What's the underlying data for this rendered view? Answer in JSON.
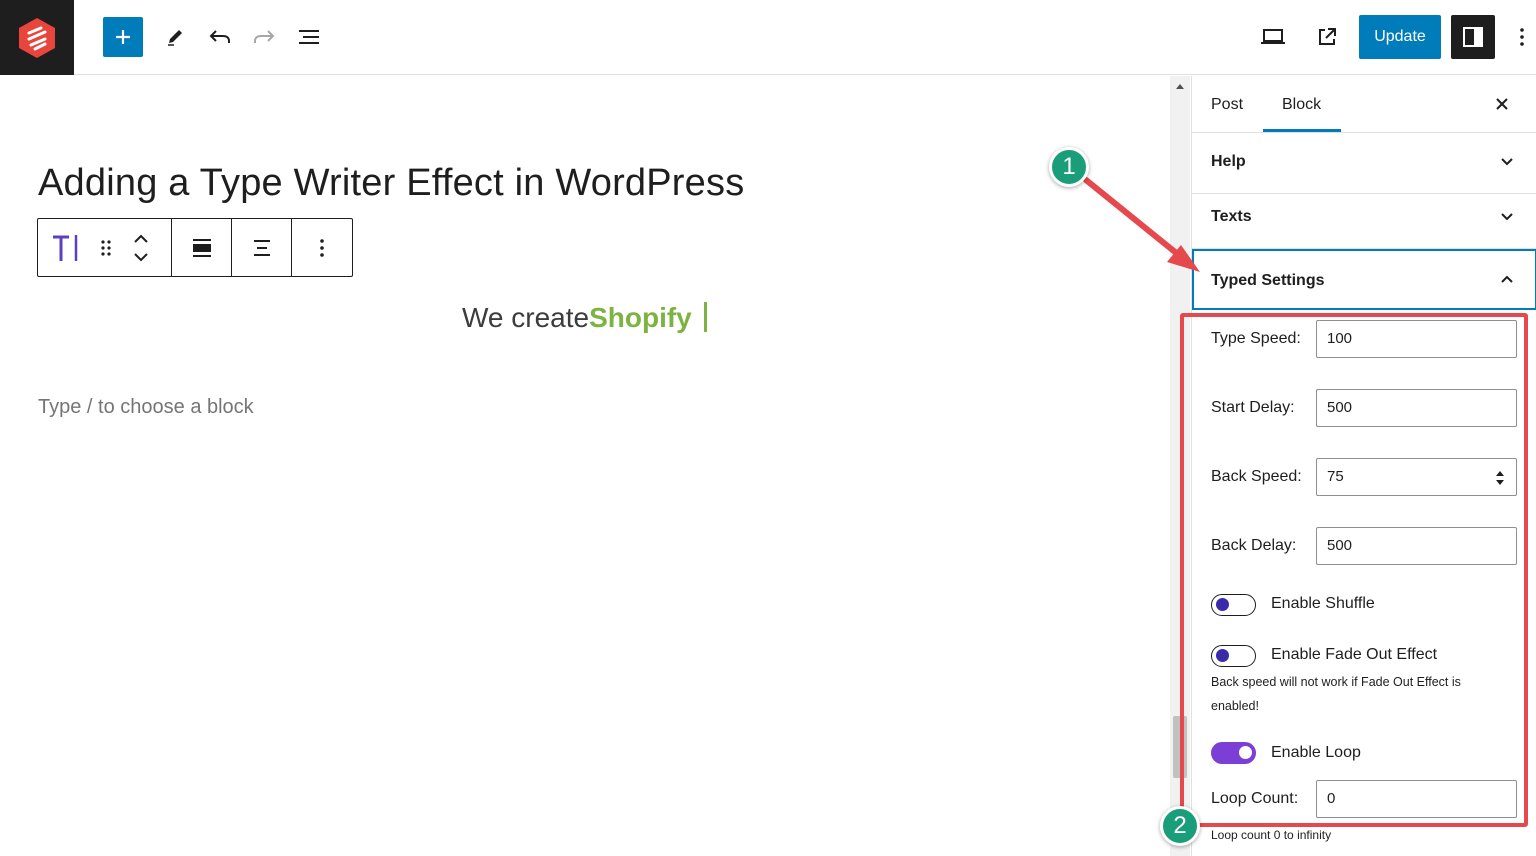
{
  "toolbar": {
    "update_label": "Update"
  },
  "editor": {
    "post_title": "Adding a Type Writer Effect in WordPress",
    "typed_prefix": "We create",
    "typed_word": "Shopify",
    "block_placeholder": "Type / to choose a block"
  },
  "sidebar": {
    "tabs": [
      {
        "label": "Post",
        "active": false
      },
      {
        "label": "Block",
        "active": true
      }
    ],
    "panels": [
      {
        "label": "Help",
        "expanded": false
      },
      {
        "label": "Texts",
        "expanded": false
      },
      {
        "label": "Typed Settings",
        "expanded": true
      }
    ],
    "typed_settings": {
      "type_speed": {
        "label": "Type Speed:",
        "value": "100"
      },
      "start_delay": {
        "label": "Start Delay:",
        "value": "500"
      },
      "back_speed": {
        "label": "Back Speed:",
        "value": "75"
      },
      "back_delay": {
        "label": "Back Delay:",
        "value": "500"
      },
      "enable_shuffle": {
        "label": "Enable Shuffle",
        "on": false
      },
      "enable_fade_out": {
        "label": "Enable Fade Out Effect",
        "on": false
      },
      "fade_help": "Back speed will not work if Fade Out Effect is enabled!",
      "enable_loop": {
        "label": "Enable Loop",
        "on": true
      },
      "loop_count": {
        "label": "Loop Count:",
        "value": "0"
      },
      "loop_help": "Loop count 0 to infinity"
    }
  },
  "annotations": {
    "badge_1": "1",
    "badge_2": "2"
  },
  "colors": {
    "accent_blue": "#007cba",
    "highlight_green": "#7cb342",
    "annotation_red": "#e5484d",
    "badge_teal": "#1a9e7a",
    "toggle_purple": "#7b3fd6"
  }
}
